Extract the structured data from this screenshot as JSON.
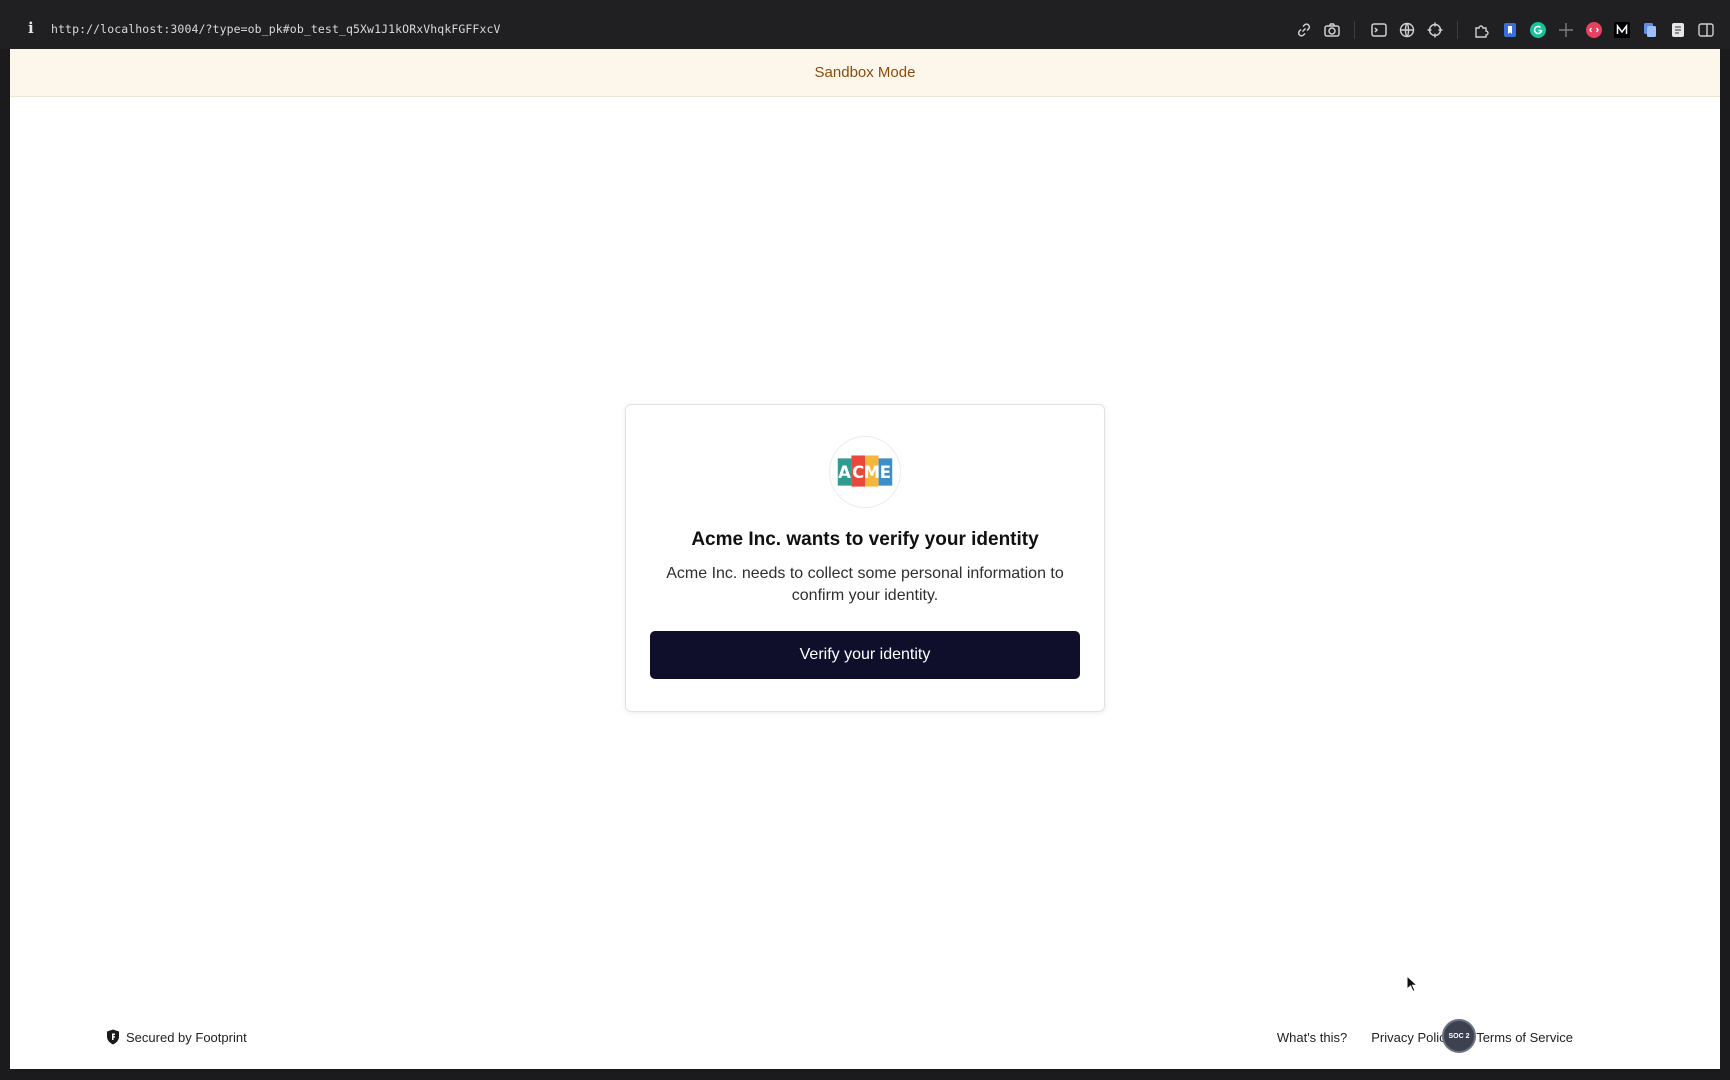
{
  "browser": {
    "url": "http://localhost:3004/?type=ob_pk#ob_test_q5Xw1J1kORxVhqkFGFFxcV",
    "info_glyph": "i",
    "toolbar_icons": [
      "link-icon",
      "camera-icon",
      "terminal-icon",
      "globe-icon",
      "crosshair-icon",
      "extension-puzzle-icon",
      "bookmark-icon",
      "grammarly-icon",
      "move-icon",
      "devtools-icon",
      "medium-icon",
      "copy-icon",
      "reader-icon",
      "sidebar-icon"
    ],
    "accent_colors": {
      "grammarly": "#15c39a",
      "bookmark": "#3b6fd8"
    }
  },
  "banner": {
    "text": "Sandbox Mode",
    "bg_color": "#fdf6ea",
    "text_color": "#8a4b0f"
  },
  "card": {
    "logo": {
      "letters": "ACME",
      "colors": [
        "#2f9c8f",
        "#e8493b",
        "#f4b63d",
        "#3c8ec9"
      ]
    },
    "title": "Acme Inc. wants to verify your identity",
    "description": "Acme Inc. needs to collect some personal information to confirm your identity.",
    "button_label": "Verify your identity",
    "button_color": "#0f0f2b"
  },
  "footer": {
    "secured_text": "Secured by Footprint",
    "links": [
      "What's this?",
      "Privacy Policy",
      "Terms of Service"
    ],
    "badge_text": "SOC 2"
  }
}
